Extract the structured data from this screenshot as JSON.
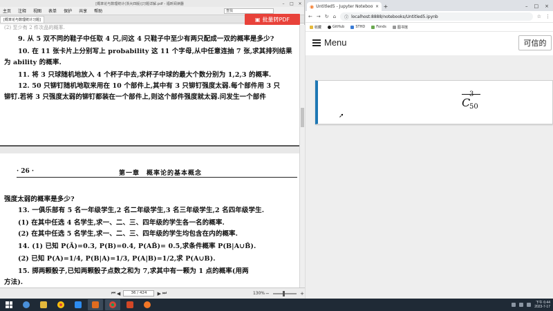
{
  "pdf_app": {
    "window_title": "[概率论与数理统计(浙大四版)]习题详解.pdf - 福昕阅读器",
    "menu": [
      "主页",
      "注释",
      "视图",
      "表单",
      "保护",
      "共享",
      "帮助"
    ],
    "tab_label": "[概率论与数理统计习题]",
    "convert_button": "批量转PDF",
    "search_placeholder": "查找",
    "page1_lines": [
      "(2) 至少有 2 件次品的概率.",
      "9. 从 5 双不同的鞋子中任取 4 只,问这 4 只鞋子中至少有两只配成一双的概率是多少?",
      "10. 在 11 张卡片上分别写上 probability 这 11 个字母,从中任意连抽 7 张,求其排列结果",
      "为 ability 的概率.",
      "11. 将 3 只球随机地放入 4 个杯子中去,求杯子中球的最大个数分别为 1,2,3 的概率.",
      "12. 50 只铆钉随机地取来用在 10 个部件上,其中有 3 只铆钉强度太弱.每个部件用 3 只",
      "铆钉.若将 3 只强度太弱的铆钉都装在一个部件上,则这个部件强度就太弱.问发生一个部件"
    ],
    "page_number": "· 26 ·",
    "chapter_header": "第一章　概率论的基本概念",
    "page2_lines": [
      "强度太弱的概率是多少?",
      "13. 一俱乐部有 5 名一年级学生,2 名二年级学生,3 名三年级学生,2 名四年级学生.",
      "(1) 在其中任选 4 名学生,求一、二、三、四年级的学生各一名的概率.",
      "(2) 在其中任选 5 名学生,求一、二、三、四年级的学生均包含在内的概率.",
      "14. (1) 已知 P(Ā)=0.3, P(B)=0.4, P(AB̄)= 0.5,求条件概率 P(B|A∪B̄).",
      "(2) 已知 P(A)=1/4, P(B|A)=1/3, P(A|B)=1/2,求 P(A∪B).",
      "15. 掷两颗骰子,已知两颗骰子点数之和为 7,求其中有一颗为 1 点的概率(用两",
      "方法)."
    ],
    "status": {
      "page_indicator": "36 / 424",
      "zoom": "130%"
    }
  },
  "browser": {
    "tab_title": "Untitled5 - Jupyter Notebook",
    "new_tab": "+",
    "url": "localhost:8888/notebooks/Untitled5.ipynb",
    "bookmarks": [
      "收藏",
      "GitHub",
      "STHD",
      "Fonds",
      "图书馆"
    ],
    "notebook": {
      "menu_label": "Menu",
      "trusted_label": "可信的",
      "formula_base": "C",
      "formula_sup": "3",
      "formula_sub": "50"
    }
  },
  "taskbar": {
    "time": "下午 6:44",
    "date": "2023-7-17"
  },
  "colors": {
    "cell_accent": "#1e77b4",
    "convert_button": "#e8423a",
    "taskbar": "#1f2a36"
  }
}
